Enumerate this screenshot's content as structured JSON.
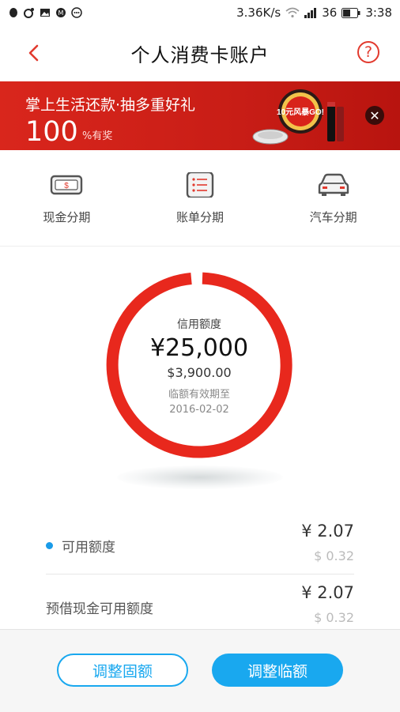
{
  "status_bar": {
    "network_speed": "3.36K/s",
    "signal_label": "36",
    "time": "3:38"
  },
  "header": {
    "title": "个人消费卡账户",
    "help_label": "?"
  },
  "banner": {
    "title": "掌上生活还款·抽多重好礼",
    "big_number": "100",
    "suffix": "%有奖",
    "art_text": "10元风暴GO!"
  },
  "quick_actions": [
    {
      "label": "现金分期",
      "icon": "cash-icon"
    },
    {
      "label": "账单分期",
      "icon": "bill-list-icon"
    },
    {
      "label": "汽车分期",
      "icon": "car-icon"
    }
  ],
  "credit": {
    "label": "信用额度",
    "amount": "¥25,000",
    "usd_amount": "$3,900.00",
    "temp_note": "临额有效期至",
    "temp_date": "2016-02-02",
    "ring_color": "#e8281d"
  },
  "balances": [
    {
      "label": "可用额度",
      "value": "¥ 2.07",
      "sub": "$ 0.32",
      "has_dot": true
    },
    {
      "label": "预借现金可用额度",
      "value": "¥ 2.07",
      "sub": "$ 0.32",
      "has_dot": false
    }
  ],
  "footer": {
    "fixed_button": "调整固额",
    "temp_button": "调整临额"
  },
  "colors": {
    "accent_blue": "#19a8ef",
    "banner_red": "#d9261c",
    "back_red": "#e23a2e"
  }
}
